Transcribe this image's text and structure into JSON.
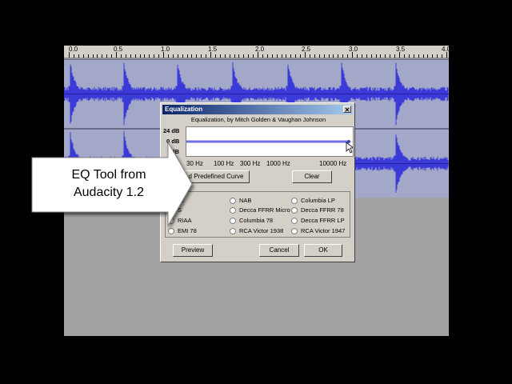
{
  "ruler": {
    "labels": [
      "0.0",
      "0.5",
      "1.0",
      "1.5",
      "2.0",
      "2.5",
      "3.0",
      "3.5",
      "4.0"
    ]
  },
  "dialog": {
    "title": "Equalization",
    "close_glyph": "✕",
    "credit": "Equalization, by Mitch Golden & Vaughan Johnson",
    "db_labels": [
      "24 dB",
      "0 dB",
      "dB"
    ],
    "freq_labels": [
      "30 Hz",
      "100 Hz",
      "300 Hz",
      "1000 Hz",
      "10000 Hz"
    ],
    "load_curve_label": "d Predefined Curve",
    "clear_label": "Clear",
    "radios": {
      "col1": [
        "bc",
        "S",
        "RIAA",
        "EMI 78"
      ],
      "col2": [
        "NAB",
        "Decca FFRR Micro",
        "Columbia 78",
        "RCA Victor 1938"
      ],
      "col3": [
        "Columbia LP",
        "Decca FFRR 78",
        "Decca FFRR LP",
        "RCA Victor 1947"
      ]
    },
    "preview_label": "Preview",
    "cancel_label": "Cancel",
    "ok_label": "OK"
  },
  "callout": {
    "line1": "EQ Tool from",
    "line2": "Audacity 1.2"
  },
  "colors": {
    "waveform": "#3a3ad8",
    "track_bg": "#a4a8c8",
    "title_start": "#0a246a",
    "title_end": "#a6caf0"
  }
}
